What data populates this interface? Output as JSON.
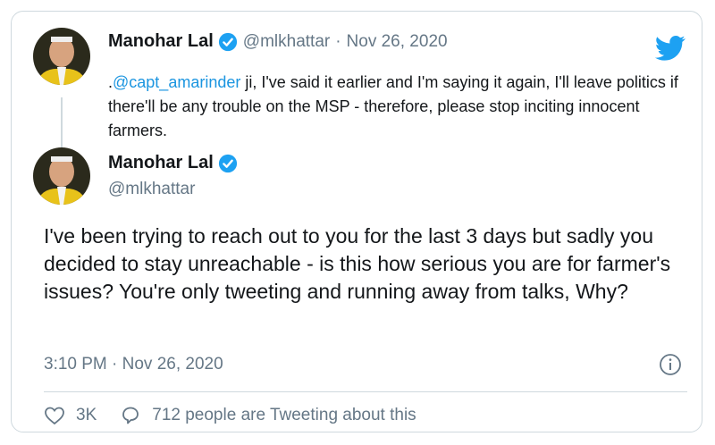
{
  "quoted": {
    "author_name": "Manohar Lal",
    "handle": "@mlkhattar",
    "separator": "·",
    "date": "Nov 26, 2020",
    "text_prefix": ".",
    "mention": "@capt_amarinder",
    "text_rest": " ji, I've said it earlier and I'm saying it again, I'll leave politics if there'll be any trouble on the MSP - therefore, please stop inciting innocent farmers."
  },
  "tweet": {
    "author_name": "Manohar Lal",
    "handle": "@mlkhattar",
    "text": "I've been trying to reach out to you for the last 3 days but sadly you decided to stay unreachable - is this how serious you are for farmer's issues? You're only tweeting and running away from talks, Why?",
    "timestamp": "3:10 PM · Nov 26, 2020"
  },
  "actions": {
    "likes": "3K",
    "reply_label": "712 people are Tweeting about this"
  },
  "colors": {
    "twitter_blue": "#1da1f2",
    "link": "#1b95e0",
    "muted": "#657786"
  },
  "icons": [
    "twitter-bird-icon",
    "verified-badge-icon",
    "info-icon",
    "heart-icon",
    "comment-icon"
  ]
}
